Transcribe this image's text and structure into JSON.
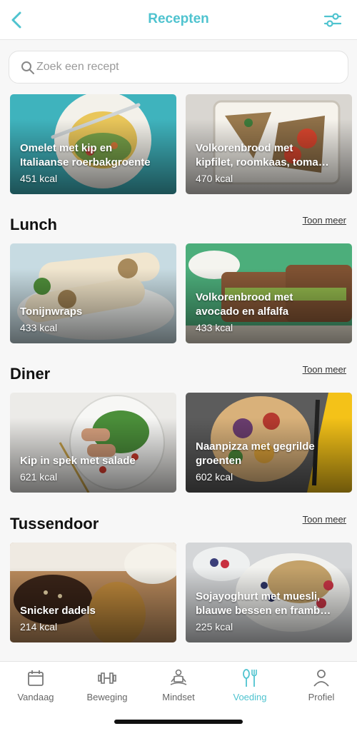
{
  "header": {
    "title": "Recepten",
    "back_icon": "chevron-left-icon",
    "filter_icon": "sliders-icon",
    "accent": "#4fc3cf"
  },
  "search": {
    "placeholder": "Zoek een recept",
    "value": ""
  },
  "sections": [
    {
      "title": "",
      "recipes": [
        {
          "name": "Omelet met kip en\nItaliaanse roerbakgroente",
          "kcal": "451 kcal"
        },
        {
          "name": "Volkorenbrood met\nkipfilet, roomkaas, toma…",
          "kcal": "470 kcal"
        }
      ]
    },
    {
      "title": "Lunch",
      "more": "Toon meer",
      "recipes": [
        {
          "name": "Tonijnwraps",
          "kcal": "433 kcal"
        },
        {
          "name": "Volkorenbrood met\navocado en alfalfa",
          "kcal": "433 kcal"
        }
      ]
    },
    {
      "title": "Diner",
      "more": "Toon meer",
      "recipes": [
        {
          "name": "Kip in spek met salade",
          "kcal": "621 kcal"
        },
        {
          "name": "Naanpizza met gegrilde\ngroenten",
          "kcal": "602 kcal"
        }
      ]
    },
    {
      "title": "Tussendoor",
      "more": "Toon meer",
      "recipes": [
        {
          "name": "Snicker dadels",
          "kcal": "214 kcal"
        },
        {
          "name": "Sojayoghurt met muesli,\nblauwe bessen en framb…",
          "kcal": "225 kcal"
        }
      ]
    }
  ],
  "tabbar": [
    {
      "label": "Vandaag",
      "icon": "calendar-icon"
    },
    {
      "label": "Beweging",
      "icon": "dumbbell-icon"
    },
    {
      "label": "Mindset",
      "icon": "meditation-icon"
    },
    {
      "label": "Voeding",
      "icon": "fork-knife-icon",
      "active": true
    },
    {
      "label": "Profiel",
      "icon": "person-icon"
    }
  ]
}
